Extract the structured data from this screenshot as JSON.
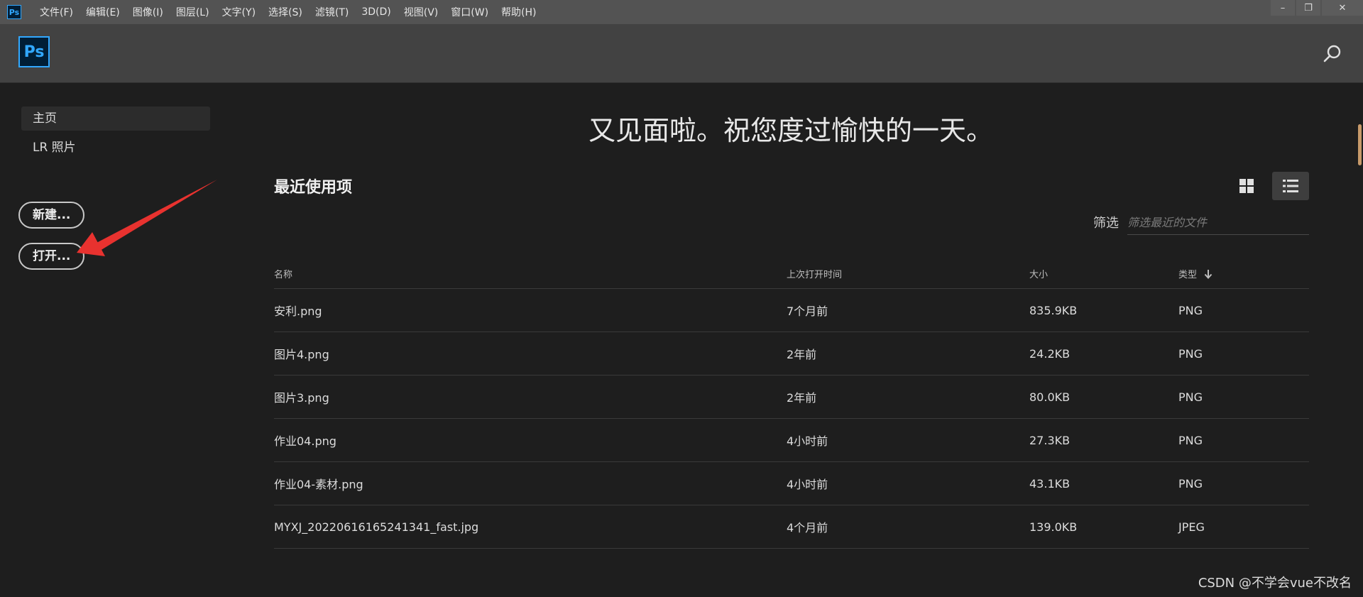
{
  "app": {
    "icon_label": "Ps"
  },
  "menu": [
    "文件(F)",
    "编辑(E)",
    "图像(I)",
    "图层(L)",
    "文字(Y)",
    "选择(S)",
    "滤镜(T)",
    "3D(D)",
    "视图(V)",
    "窗口(W)",
    "帮助(H)"
  ],
  "window_controls": {
    "minimize": "–",
    "restore": "❐",
    "close": "✕"
  },
  "header": {
    "logo": "Ps"
  },
  "sidebar": {
    "items": [
      {
        "label": "主页",
        "active": true
      },
      {
        "label": "LR 照片",
        "active": false
      }
    ],
    "new_button": "新建...",
    "open_button": "打开..."
  },
  "main": {
    "greeting": "又见面啦。祝您度过愉快的一天。",
    "recent_title": "最近使用项",
    "filter_label": "筛选",
    "filter_placeholder": "筛选最近的文件",
    "table": {
      "headers": {
        "name": "名称",
        "last_opened": "上次打开时间",
        "size": "大小",
        "type": "类型"
      },
      "rows": [
        {
          "name": "安利.png",
          "last_opened": "7个月前",
          "size": "835.9KB",
          "type": "PNG"
        },
        {
          "name": "图片4.png",
          "last_opened": "2年前",
          "size": "24.2KB",
          "type": "PNG"
        },
        {
          "name": "图片3.png",
          "last_opened": "2年前",
          "size": "80.0KB",
          "type": "PNG"
        },
        {
          "name": "作业04.png",
          "last_opened": "4小时前",
          "size": "27.3KB",
          "type": "PNG"
        },
        {
          "name": "作业04-素材.png",
          "last_opened": "4小时前",
          "size": "43.1KB",
          "type": "PNG"
        },
        {
          "name": "MYXJ_20220616165241341_fast.jpg",
          "last_opened": "4个月前",
          "size": "139.0KB",
          "type": "JPEG"
        }
      ]
    }
  },
  "watermark": "CSDN @不学会vue不改名",
  "colors": {
    "accent": "#31a8ff",
    "annotation": "#e8322f",
    "scroll": "#c79a6a"
  }
}
